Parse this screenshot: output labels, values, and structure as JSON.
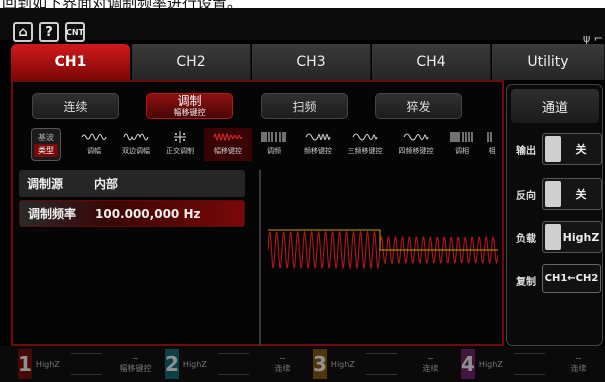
{
  "caption": "回到如下界面对调制频率进行设置。",
  "topbar": {
    "icons": [
      "home-icon",
      "help-icon",
      "cnt-icon"
    ],
    "usb_glyph": "ψ ⌐"
  },
  "tabs": [
    {
      "label": "CH1",
      "active": true
    },
    {
      "label": "CH2",
      "active": false
    },
    {
      "label": "CH3",
      "active": false
    },
    {
      "label": "CH4",
      "active": false
    },
    {
      "label": "Utility",
      "active": false
    }
  ],
  "modes": [
    {
      "label": "连续",
      "sub": ""
    },
    {
      "label": "调制",
      "sub": "幅移键控",
      "active": true
    },
    {
      "label": "扫频",
      "sub": ""
    },
    {
      "label": "猝发",
      "sub": ""
    }
  ],
  "type_box": {
    "top": "基波",
    "bottom": "类型"
  },
  "mod_types": [
    "调幅",
    "双边调幅",
    "正交调制",
    "幅移键控",
    "调频",
    "频移键控",
    "三频移键控",
    "四频移键控",
    "调相",
    "相"
  ],
  "params": {
    "source": {
      "label": "调制源",
      "value": "内部"
    },
    "freq": {
      "label": "调制频率",
      "value": "100.000,000 Hz"
    }
  },
  "right": {
    "header": "通道",
    "output": {
      "label": "输出",
      "value": "关"
    },
    "invert": {
      "label": "反向",
      "value": "关"
    },
    "load": {
      "label": "负载",
      "value": "HighZ"
    },
    "copy": {
      "label": "复制",
      "value": "CH1←CH2"
    }
  },
  "bottom": [
    {
      "num": "1",
      "imp": "HighZ",
      "mode": "幅移键控",
      "color": "#c01010"
    },
    {
      "num": "2",
      "imp": "HighZ",
      "mode": "连续",
      "color": "#1aa0b0"
    },
    {
      "num": "3",
      "imp": "HighZ",
      "mode": "连续",
      "color": "#d68a10"
    },
    {
      "num": "4",
      "imp": "HighZ",
      "mode": "连续",
      "color": "#b03aa8"
    }
  ],
  "colors": {
    "accent": "#c01010",
    "wave": "#b01818",
    "gate": "#c8a000"
  }
}
